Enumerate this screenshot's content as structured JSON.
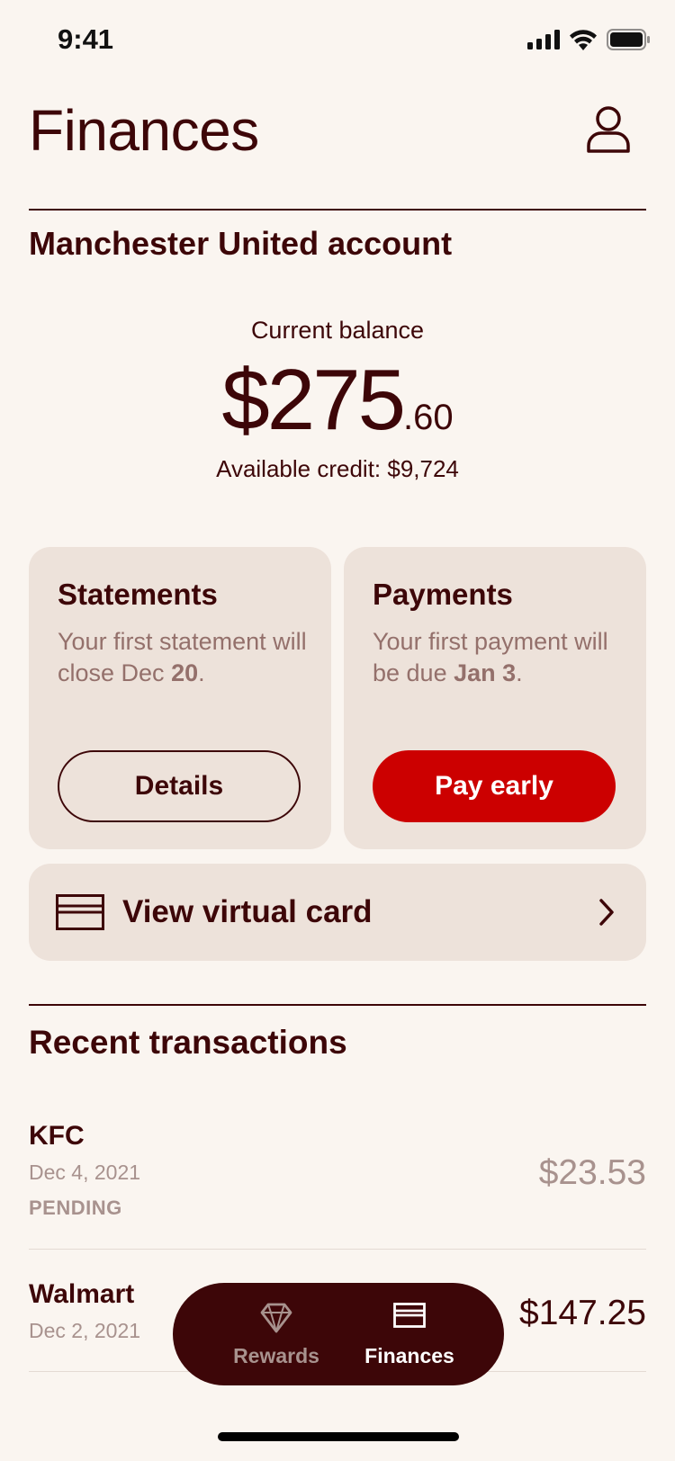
{
  "status_bar": {
    "time": "9:41"
  },
  "header": {
    "title": "Finances"
  },
  "account": {
    "title": "Manchester United account",
    "balance_label": "Current balance",
    "balance_dollars": "$275",
    "balance_cents": ".60",
    "available_credit": "Available credit: $9,724"
  },
  "statements": {
    "title": "Statements",
    "text_prefix": "Your first statement will close Dec ",
    "text_bold": "20",
    "text_suffix": ".",
    "button_label": "Details"
  },
  "payments": {
    "title": "Payments",
    "text_prefix": "Your first payment will be due ",
    "text_bold": "Jan 3",
    "text_suffix": ".",
    "button_label": "Pay early"
  },
  "virtual_card": {
    "label": "View virtual card"
  },
  "transactions": {
    "title": "Recent transactions",
    "items": [
      {
        "name": "KFC",
        "date": "Dec 4, 2021",
        "status": "PENDING",
        "amount": "$23.53"
      },
      {
        "name": "Walmart",
        "date": "Dec 2, 2021",
        "status": "",
        "amount": "$147.25"
      }
    ]
  },
  "tab_bar": {
    "tabs": [
      {
        "label": "Rewards",
        "icon": "diamond-icon",
        "active": false
      },
      {
        "label": "Finances",
        "icon": "card-icon",
        "active": true
      }
    ]
  },
  "colors": {
    "background": "#FAF5F0",
    "text": "#3D0608",
    "card": "#EDE2DA",
    "accent": "#CC0000",
    "muted": "#A8928E"
  }
}
